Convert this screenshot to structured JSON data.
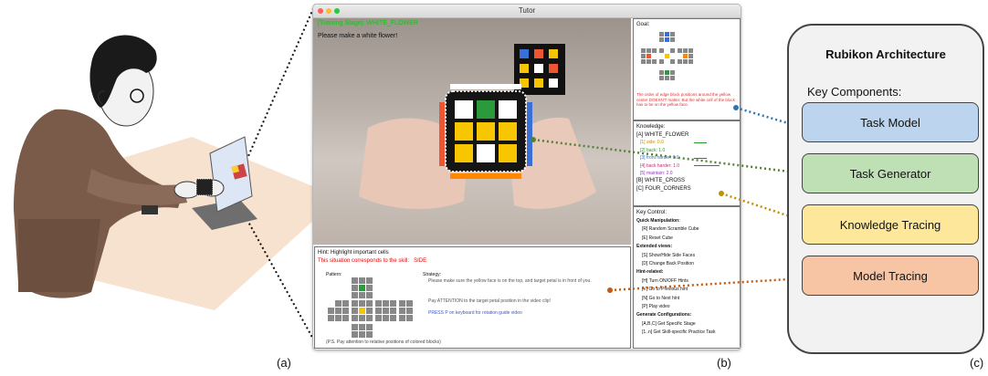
{
  "window": {
    "title": "Tutor"
  },
  "video_overlay": {
    "stage": "[Tutoring Stage]: WHITE_FLOWER",
    "instruction": "Please make a white flower!"
  },
  "goal": {
    "heading": "Goal:",
    "description": "The order of edge block positions around the yellow center DOESN'T matter. But the white cell of the block has to be on the yellow face."
  },
  "knowledge": {
    "heading": "Knowledge:",
    "items": [
      {
        "label": "[A] WHITE_FLOWER",
        "color": "#111111"
      },
      {
        "label": "[1] side: 0.0",
        "color": "#d08a00"
      },
      {
        "label": "[2] back: 1.0",
        "color": "#2a9a2a"
      },
      {
        "label": "[3] front harder: 0.0",
        "color": "#2a6fd0"
      },
      {
        "label": "[4] back harder: 1.0",
        "color": "#c0306a"
      },
      {
        "label": "[5] maintain: 2.0",
        "color": "#8a3cc0"
      },
      {
        "label": "[B] WHITE_CROSS",
        "color": "#111111"
      },
      {
        "label": "[C] FOUR_CORNERS",
        "color": "#111111"
      }
    ]
  },
  "key_control": {
    "heading": "Key Control:",
    "lines": [
      {
        "text": "Quick Manipulation:",
        "bold": true
      },
      {
        "text": "[R] Random Scramble Cube",
        "bold": false
      },
      {
        "text": "[E] Reset Cube",
        "bold": false
      },
      {
        "text": "Extended views:",
        "bold": true
      },
      {
        "text": "[S] Show/Hide Side Faces",
        "bold": false
      },
      {
        "text": "[D] Change Back Position",
        "bold": false
      },
      {
        "text": "Hint-related:",
        "bold": true
      },
      {
        "text": "[H] Turn ON/OFF Hints",
        "bold": false
      },
      {
        "text": "[V] Go to Previous hint",
        "bold": false
      },
      {
        "text": "[N] Go to Next hint",
        "bold": false
      },
      {
        "text": "[P] Play video",
        "bold": false
      },
      {
        "text": "Generate Configurations:",
        "bold": true
      },
      {
        "text": "[A,B,C] Get Specific Stage",
        "bold": false
      },
      {
        "text": "[1..n] Get Skill-specific Practice Task",
        "bold": false
      }
    ]
  },
  "hint": {
    "title": "Hint: Highlight important cells",
    "situation_prefix": "This situation corresponds to the skill:",
    "skill": "SIDE",
    "pattern_label": "Pattern:",
    "strategy_label": "Strategy:",
    "strategy_text": "Please make sure the yellow face is on the top, and target petal is in front of you.",
    "attention_text": "Pay ATTENTION to the target petal position in the video clip!",
    "press_text": "PRESS P on keyboard for rotation guide video",
    "footer": "(P.S. Pay attention to relative positions of colored blocks)"
  },
  "architecture": {
    "title": "Rubikon Architecture",
    "subtitle": "Key Components:",
    "components": [
      {
        "label": "Task Model",
        "color": "#bcd4ee"
      },
      {
        "label": "Task Generator",
        "color": "#bfe0b4"
      },
      {
        "label": "Knowledge Tracing",
        "color": "#fde79a"
      },
      {
        "label": "Model Tracing",
        "color": "#f7c4a4"
      }
    ]
  },
  "captions": {
    "a": "(a)",
    "b": "(b)",
    "c": "(c)"
  },
  "connector_colors": {
    "task_model": "#2e75b6",
    "task_generator": "#548235",
    "knowledge_tracing": "#bf9000",
    "model_tracing": "#c55a11"
  }
}
